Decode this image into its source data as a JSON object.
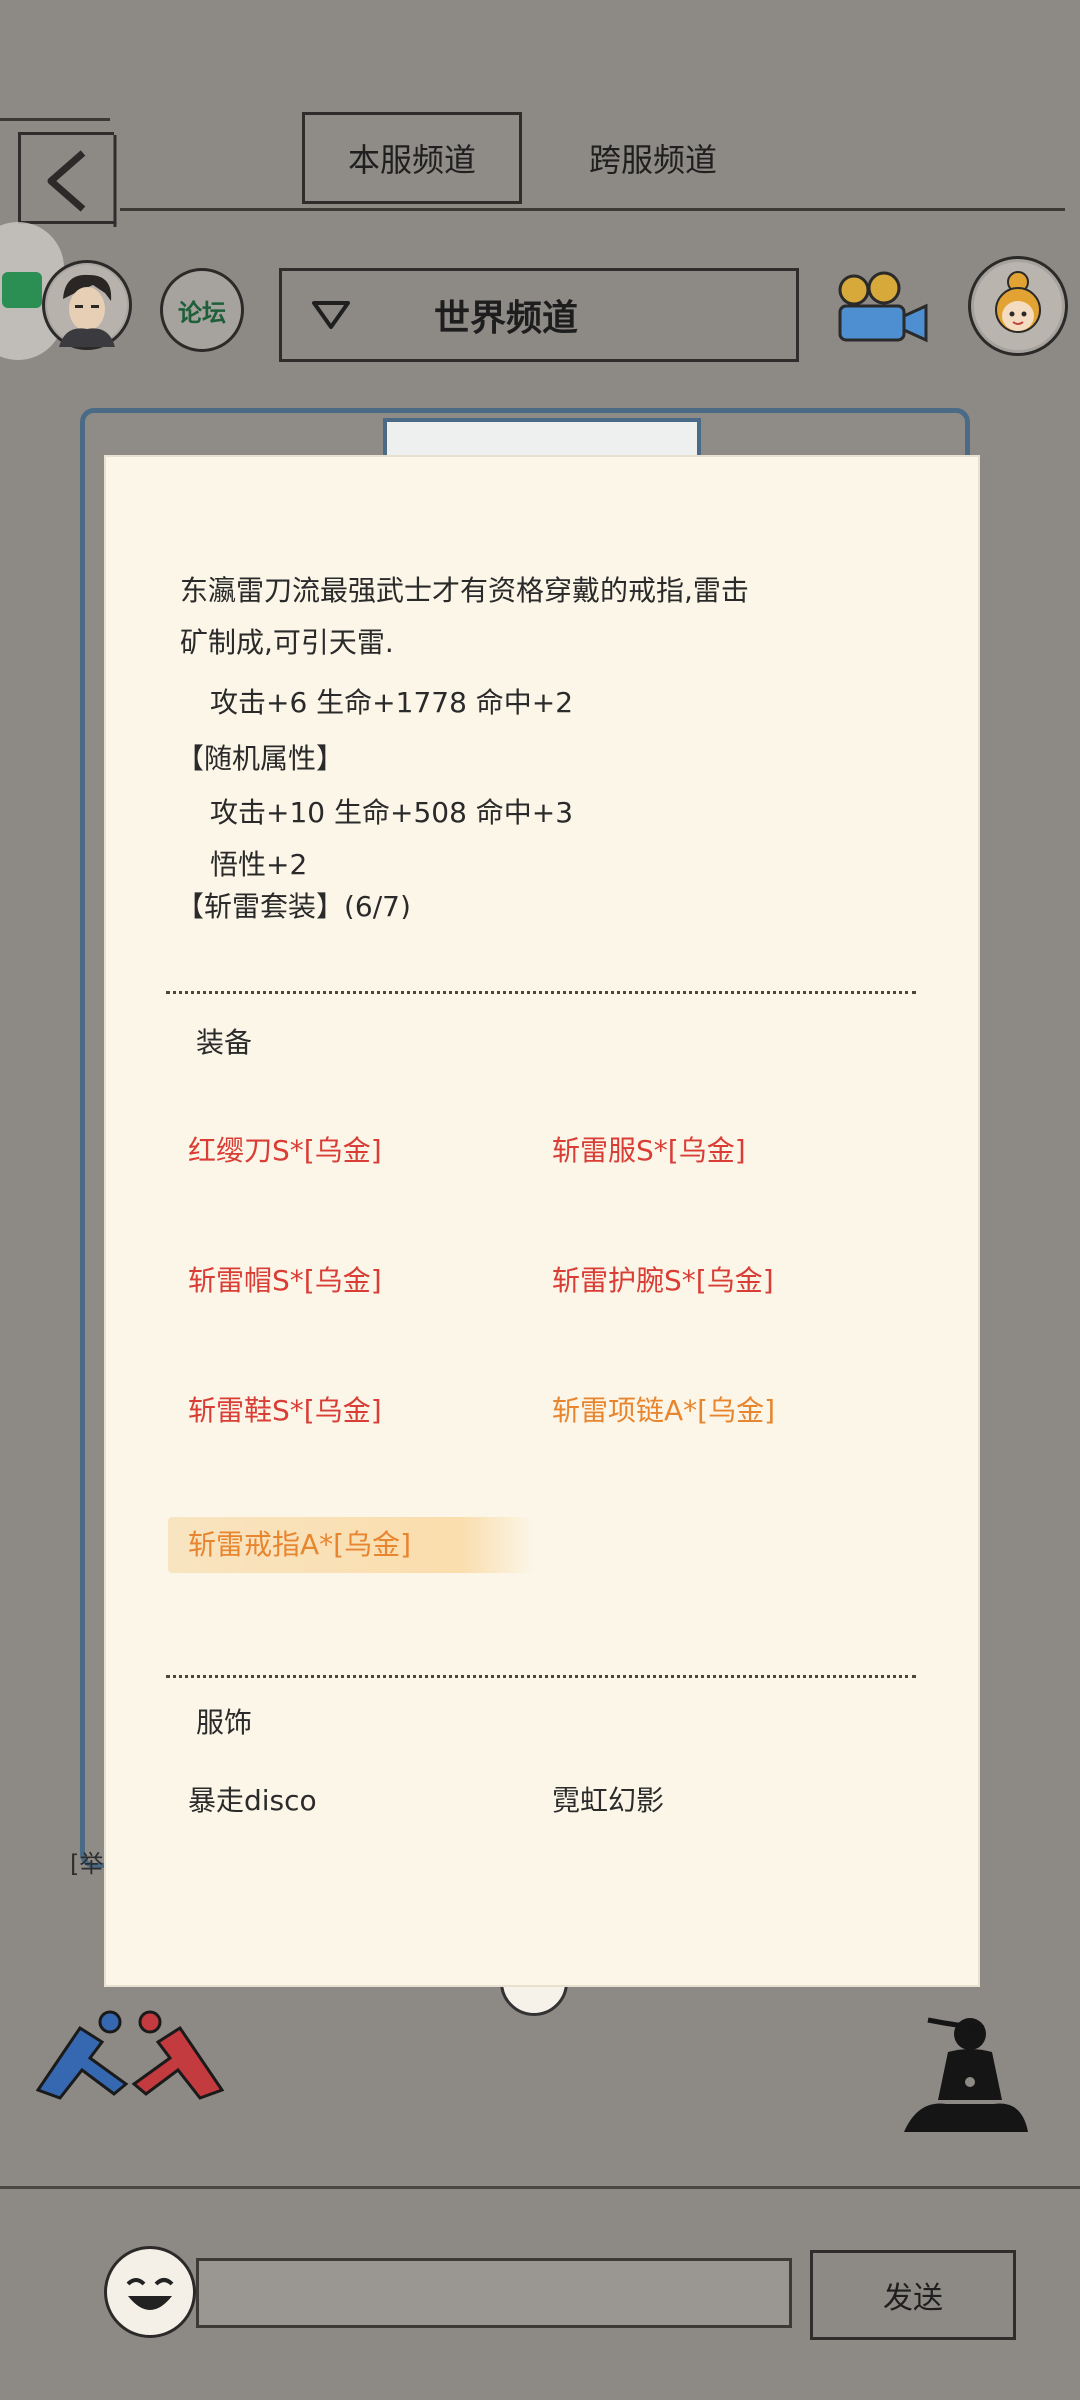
{
  "header": {
    "tabs": [
      {
        "label": "本服频道",
        "active": true
      },
      {
        "label": "跨服频道",
        "active": false
      }
    ]
  },
  "toolbar": {
    "forum_label": "论坛",
    "channel_select_label": "世界频道"
  },
  "item_panel": {
    "description_lines": [
      "东瀛雷刀流最强武士才有资格穿戴的戒指,雷击",
      "矿制成,可引天雷.",
      "攻击+6 生命+1778 命中+2",
      "【随机属性】",
      "攻击+10 生命+508 命中+3",
      "悟性+2",
      "【斩雷套装】(6/7)"
    ],
    "equipment_section_label": "装备",
    "equipment": [
      {
        "label": "红缨刀S*[乌金]",
        "color": "#d93d35"
      },
      {
        "label": "斩雷服S*[乌金]",
        "color": "#d93d35"
      },
      {
        "label": "斩雷帽S*[乌金]",
        "color": "#d93d35"
      },
      {
        "label": "斩雷护腕S*[乌金]",
        "color": "#d93d35"
      },
      {
        "label": "斩雷鞋S*[乌金]",
        "color": "#d93d35"
      },
      {
        "label": "斩雷项链A*[乌金]",
        "color": "#e8852f"
      },
      {
        "label": "斩雷戒指A*[乌金]",
        "color": "#e8852f"
      }
    ],
    "costume_section_label": "服饰",
    "costumes": [
      {
        "label": "暴走disco"
      },
      {
        "label": "霓虹幻影"
      }
    ]
  },
  "background_fragments": {
    "left_bracket_text": "[举"
  },
  "footer": {
    "send_button_label": "发送",
    "message_input_value": ""
  },
  "colors": {
    "page_bg": "#8d8a86",
    "panel_bg": "#fbf6e8",
    "set_red": "#d93d35",
    "set_orange": "#e8852f"
  }
}
